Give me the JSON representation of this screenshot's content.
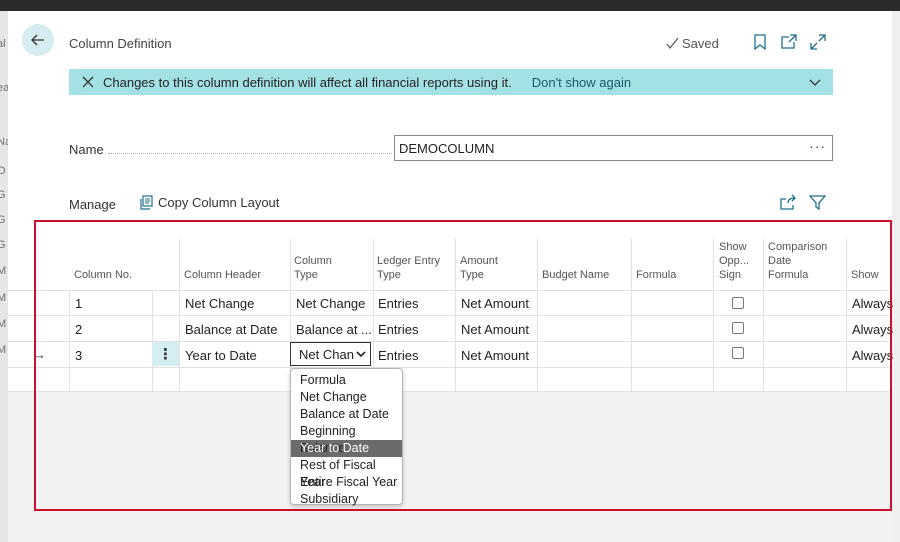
{
  "window": {
    "title": "Column Definition",
    "saved_label": "Saved",
    "icons": [
      "back-arrow-icon",
      "check-icon",
      "bookmark-icon",
      "open-in-new-icon",
      "expand-icon"
    ]
  },
  "banner": {
    "message": "Changes to this column definition will affect all financial reports using it.",
    "dont_show": "Don't show again",
    "icons": [
      "close-icon",
      "chevron-down-icon"
    ]
  },
  "form": {
    "name_label": "Name",
    "name_value": "DEMOCOLUMN",
    "more_label": "···"
  },
  "actions": {
    "manage": "Manage",
    "copy_layout": "Copy Column Layout",
    "icons": [
      "copy-icon",
      "share-icon",
      "filter-icon"
    ]
  },
  "background_fragments": [
    "al",
    "ea",
    "Na",
    "O",
    "G",
    "G",
    "G",
    "M",
    "M",
    "M",
    "M"
  ],
  "grid": {
    "headers": {
      "column_no": "Column No.",
      "column_header": "Column Header",
      "column_type": [
        "Column",
        "Type"
      ],
      "ledger_entry_type": [
        "Ledger Entry",
        "Type"
      ],
      "amount_type": [
        "Amount",
        "Type"
      ],
      "budget_name": "Budget Name",
      "formula": "Formula",
      "show_opp_sign": [
        "Show",
        "Opp...",
        "Sign"
      ],
      "comparison_date_formula": [
        "Comparison",
        "Date",
        "Formula"
      ],
      "show": "Show"
    },
    "rows": [
      {
        "column_no": "1",
        "column_header": "Net Change",
        "column_type": "Net Change",
        "ledger_entry_type": "Entries",
        "amount_type": "Net Amount",
        "show_opp_sign": false,
        "show": "Always"
      },
      {
        "column_no": "2",
        "column_header": "Balance at Date",
        "column_type": "Balance at ...",
        "ledger_entry_type": "Entries",
        "amount_type": "Net Amount",
        "show_opp_sign": false,
        "show": "Always"
      },
      {
        "column_no": "3",
        "column_header": "Year to Date",
        "column_type": "Net Chan",
        "ledger_entry_type": "Entries",
        "amount_type": "Net Amount",
        "show_opp_sign": false,
        "show": "Always"
      }
    ],
    "row_marker": "→",
    "kebab": "⋮"
  },
  "dropdown": {
    "options": [
      "Formula",
      "Net Change",
      "Balance at Date",
      "Beginning Balance",
      "Year to Date",
      "Rest of Fiscal Year",
      "Entire Fiscal Year",
      "Subsidiary"
    ],
    "highlighted": "Year to Date"
  },
  "colors": {
    "accent": "#a3e1e5",
    "highlight_frame": "#c8102e",
    "selected_option": "#6b6b6b"
  }
}
